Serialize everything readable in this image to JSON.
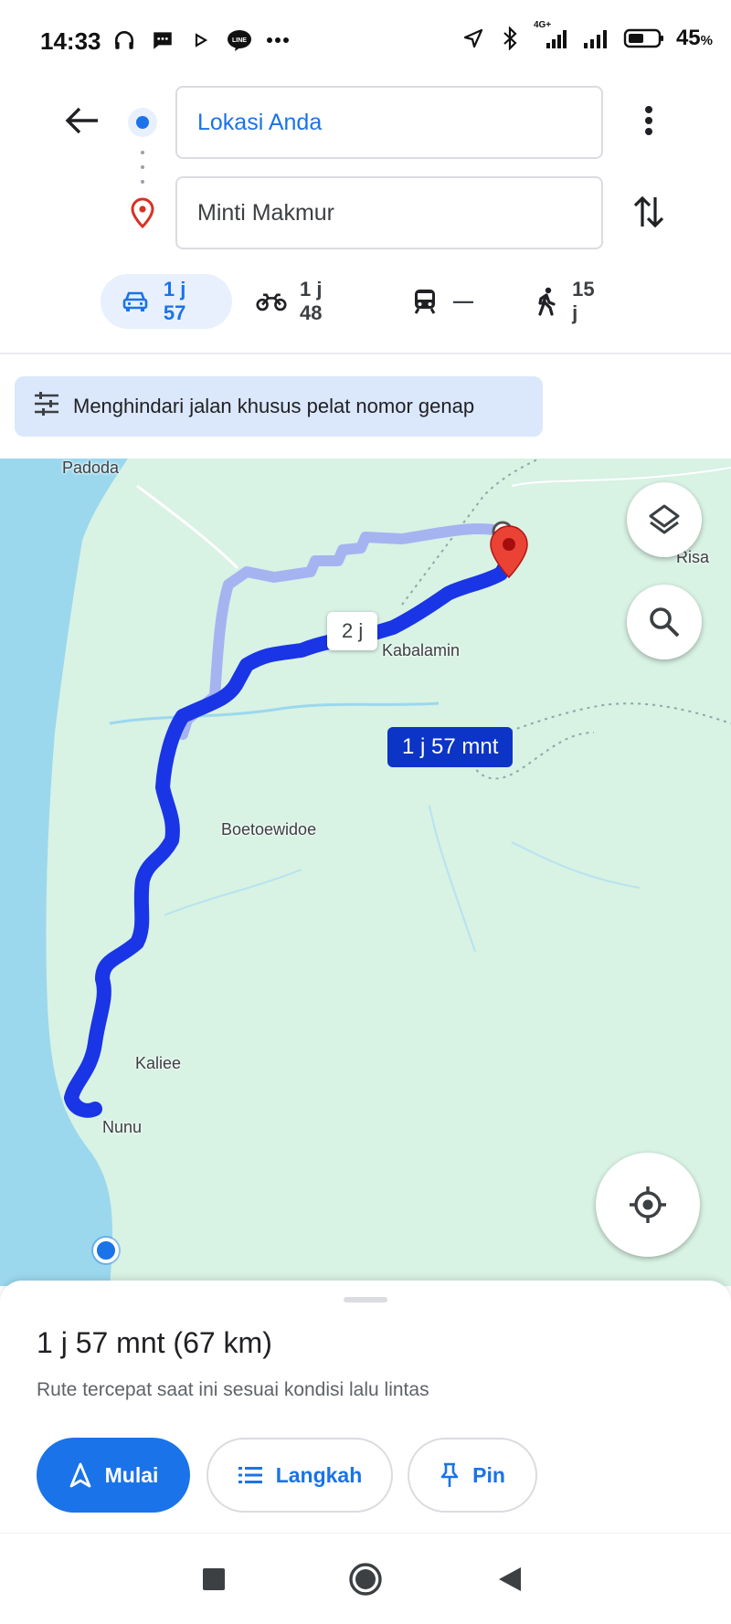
{
  "status_bar": {
    "time": "14:33",
    "battery_percent": "45",
    "battery_unit": "%",
    "network_label": "4G+",
    "left_icons": [
      "headphones-icon",
      "message-icon",
      "play-icon",
      "line-app-icon",
      "more-dots-icon"
    ],
    "right_icons": [
      "location-arrow-icon",
      "bluetooth-icon",
      "signal-icon",
      "signal-icon",
      "battery-icon"
    ]
  },
  "directions": {
    "origin_value": "Lokasi Anda",
    "destination_value": "Minti Makmur"
  },
  "travel_modes": [
    {
      "id": "car",
      "icon": "car-icon",
      "label": "1 j 57",
      "active": true
    },
    {
      "id": "motorcycle",
      "icon": "motorcycle-icon",
      "label": "1 j 48",
      "active": false
    },
    {
      "id": "transit",
      "icon": "train-icon",
      "label": "—",
      "active": false
    },
    {
      "id": "walk",
      "icon": "walk-icon",
      "label": "15 j",
      "active": false
    }
  ],
  "filter_chip": {
    "icon": "tune-icon",
    "label": "Menghindari jalan khusus pelat nomor genap"
  },
  "map": {
    "labels": {
      "padoda": "Padoda",
      "risa": "Risa",
      "kabalamin": "Kabalamin",
      "boetoewidoe": "Boetoewidoe",
      "kaliee": "Kaliee",
      "nunu": "Nunu"
    },
    "route_tags": {
      "alternative": "2 j",
      "selected": "1 j 57 mnt"
    },
    "colors": {
      "land": "#d8f2e4",
      "water": "#9bd8ee",
      "route_main": "#1a35e6",
      "route_alt": "#a5b4f0",
      "dest_pin": "#ea4335"
    }
  },
  "bottom_sheet": {
    "summary": "1 j 57 mnt (67 km)",
    "subtitle": "Rute tercepat saat ini sesuai kondisi lalu lintas",
    "start_label": "Mulai",
    "steps_label": "Langkah",
    "pin_label": "Pin"
  },
  "nav_bar": {
    "icons": [
      "recents-icon",
      "home-icon",
      "back-icon"
    ]
  }
}
